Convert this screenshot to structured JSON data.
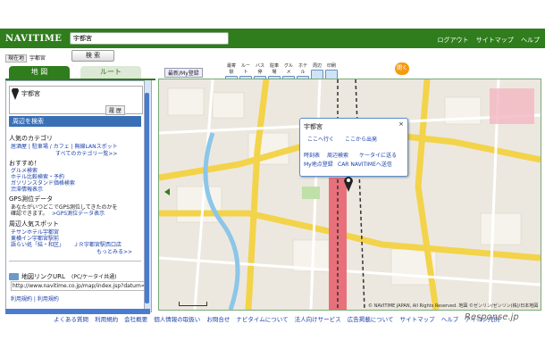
{
  "header": {
    "logo": "NAVITIME",
    "search_value": "宇都宮",
    "search_button": "検 索",
    "links": [
      "ログアウト",
      "サイトマップ",
      "ヘルプ"
    ],
    "current_position_tag": "現在地",
    "current_position": "宇都宮"
  },
  "tabs": {
    "map": "地 図",
    "route": "ルート"
  },
  "left_panel": {
    "destination": "宇都宮",
    "history_btn": "履 歴",
    "section_header": "周辺を検索",
    "popular_heading": "人気のカテゴリ",
    "popular_line1": "居酒屋 | 駐車場 / カフェ | 無線LANスポット",
    "popular_more": "すべてのカテゴリ一覧>>",
    "recommend_heading": "おすすめ！",
    "recommend_items": [
      "グルメ検索",
      "ホテル比較検索・予約",
      "ガソリンスタンド価格検索",
      "渋滞情報表示"
    ],
    "gps_heading": "GPS測位データ",
    "gps_line1": "あなたがいつどこでGPS測位してきたのかを",
    "gps_line2": "確認できます。",
    "gps_link": ">GPS測位データ表示",
    "spots_heading": "周辺人気スポット",
    "spots": [
      "チサンホテル宇都宮",
      "東横イン宇都宮駅前",
      "語らい処「結・和区」",
      "ＪＲ宇都宮駅西口店"
    ],
    "spots_more": "もっとみる>>",
    "link_url_title": "地図リンクURL",
    "link_url_sub": "(PC/ケータイ共通)",
    "link_url": "http://www.navitime.co.jp/map/index.jsp?datum=1&um",
    "bottom_links": "利用規約 | 利用規約"
  },
  "map": {
    "register_btn": "最新/My登録",
    "toolbar": [
      "最寄駅",
      "ルート",
      "バス停",
      "駐車場",
      "グルメ",
      "ホテル",
      "周辺",
      "印刷"
    ],
    "open_btn": "開く",
    "popup": {
      "title": "宇都宮",
      "go_here": "ここへ行く",
      "from_here": "ここから出発",
      "timetable": "時刻表",
      "nearby": "周辺検索",
      "send_mobile": "ケータイに送る",
      "my_register": "My地点登録",
      "car_send": "CAR NAVITIMEへ送信"
    },
    "copyright": "© NAVITIME JAPAN, All Rights Reserved. 地図 ©ゼンリン/ゼンリン(株)/日本地図"
  },
  "footer": {
    "links": [
      "よくある質問",
      "利用規約",
      "会社概要",
      "個人情報の取扱い",
      "お問合せ",
      "ナビタイムについて",
      "法人向けサービス",
      "広告掲載について",
      "サイトマップ",
      "ヘルプ",
      "アイコン凡例"
    ],
    "watermark": "Response.jp"
  },
  "colors": {
    "brand_green": "#2f7d1c",
    "link_blue": "#1a3fa8",
    "rail_red": "#e8707a"
  }
}
